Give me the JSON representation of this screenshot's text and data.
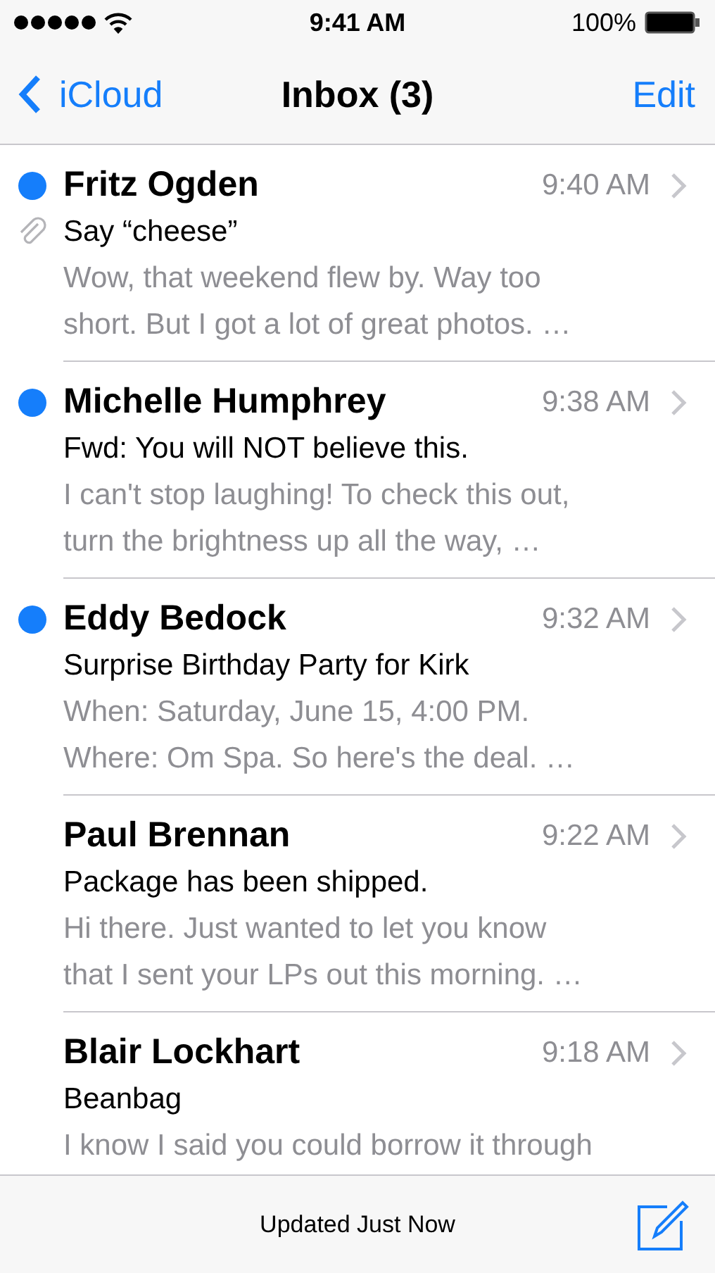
{
  "status_bar": {
    "time": "9:41 AM",
    "battery": "100%"
  },
  "nav": {
    "back": "iCloud",
    "title": "Inbox (3)",
    "action": "Edit"
  },
  "messages": [
    {
      "sender": "Fritz Ogden",
      "time": "9:40 AM",
      "subject": "Say “cheese”",
      "preview_lines": [
        "Wow, that weekend flew by. Way too",
        "short. But I got a lot of great photos. …"
      ],
      "unread": true,
      "attachment": true
    },
    {
      "sender": "Michelle Humphrey",
      "time": "9:38 AM",
      "subject": "Fwd: You will NOT believe this.",
      "preview_lines": [
        "I can't stop laughing! To check this out,",
        "turn the brightness up all the way, …"
      ],
      "unread": true,
      "attachment": false
    },
    {
      "sender": "Eddy Bedock",
      "time": "9:32 AM",
      "subject": "Surprise Birthday Party for Kirk",
      "preview_lines": [
        "When: Saturday, June 15, 4:00 PM.",
        "Where: Om Spa. So here's the deal. …"
      ],
      "unread": true,
      "attachment": false
    },
    {
      "sender": "Paul Brennan",
      "time": "9:22 AM",
      "subject": "Package has been shipped.",
      "preview_lines": [
        "Hi there. Just wanted to let you know",
        "that I sent your LPs out this morning. …"
      ],
      "unread": false,
      "attachment": false
    },
    {
      "sender": "Blair Lockhart",
      "time": "9:18 AM",
      "subject": "Beanbag",
      "preview_lines": [
        "I know I said you could borrow it through"
      ],
      "unread": false,
      "attachment": false
    }
  ],
  "toolbar": {
    "status": "Updated Just Now"
  }
}
